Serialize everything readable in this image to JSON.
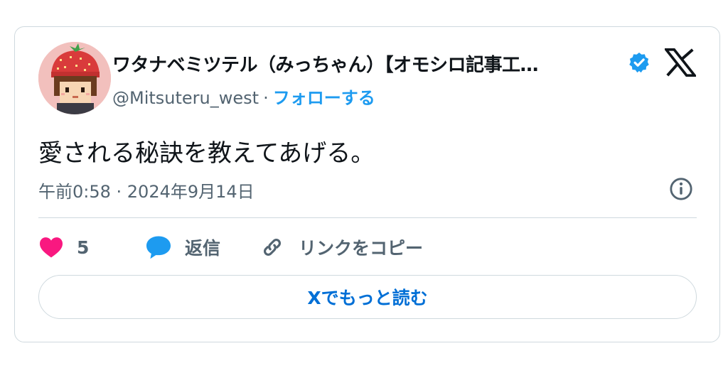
{
  "author": {
    "display_name": "ワタナベミツテル（みっちゃん）【オモシロ記事工…",
    "handle": "@Mitsuteru_west",
    "separator": "·",
    "follow_label": "フォローする",
    "verified_icon": "verified-badge-icon",
    "avatar": "avatar-strawberry-hat"
  },
  "tweet": {
    "text": "愛される秘訣を教えてあげる。",
    "timestamp": "午前0:58 · 2024年9月14日"
  },
  "actions": {
    "like_icon": "heart-icon",
    "like_count": "5",
    "reply_icon": "reply-bubble-icon",
    "reply_label": "返信",
    "copy_icon": "link-icon",
    "copy_label": "リンクをコピー"
  },
  "read_more_label": "Xでもっと読む",
  "colors": {
    "accent": "#1d9bf0",
    "link": "#006fd6",
    "like": "#f91880",
    "text": "#0f1419",
    "muted": "#536471",
    "border": "#cfd9de"
  }
}
